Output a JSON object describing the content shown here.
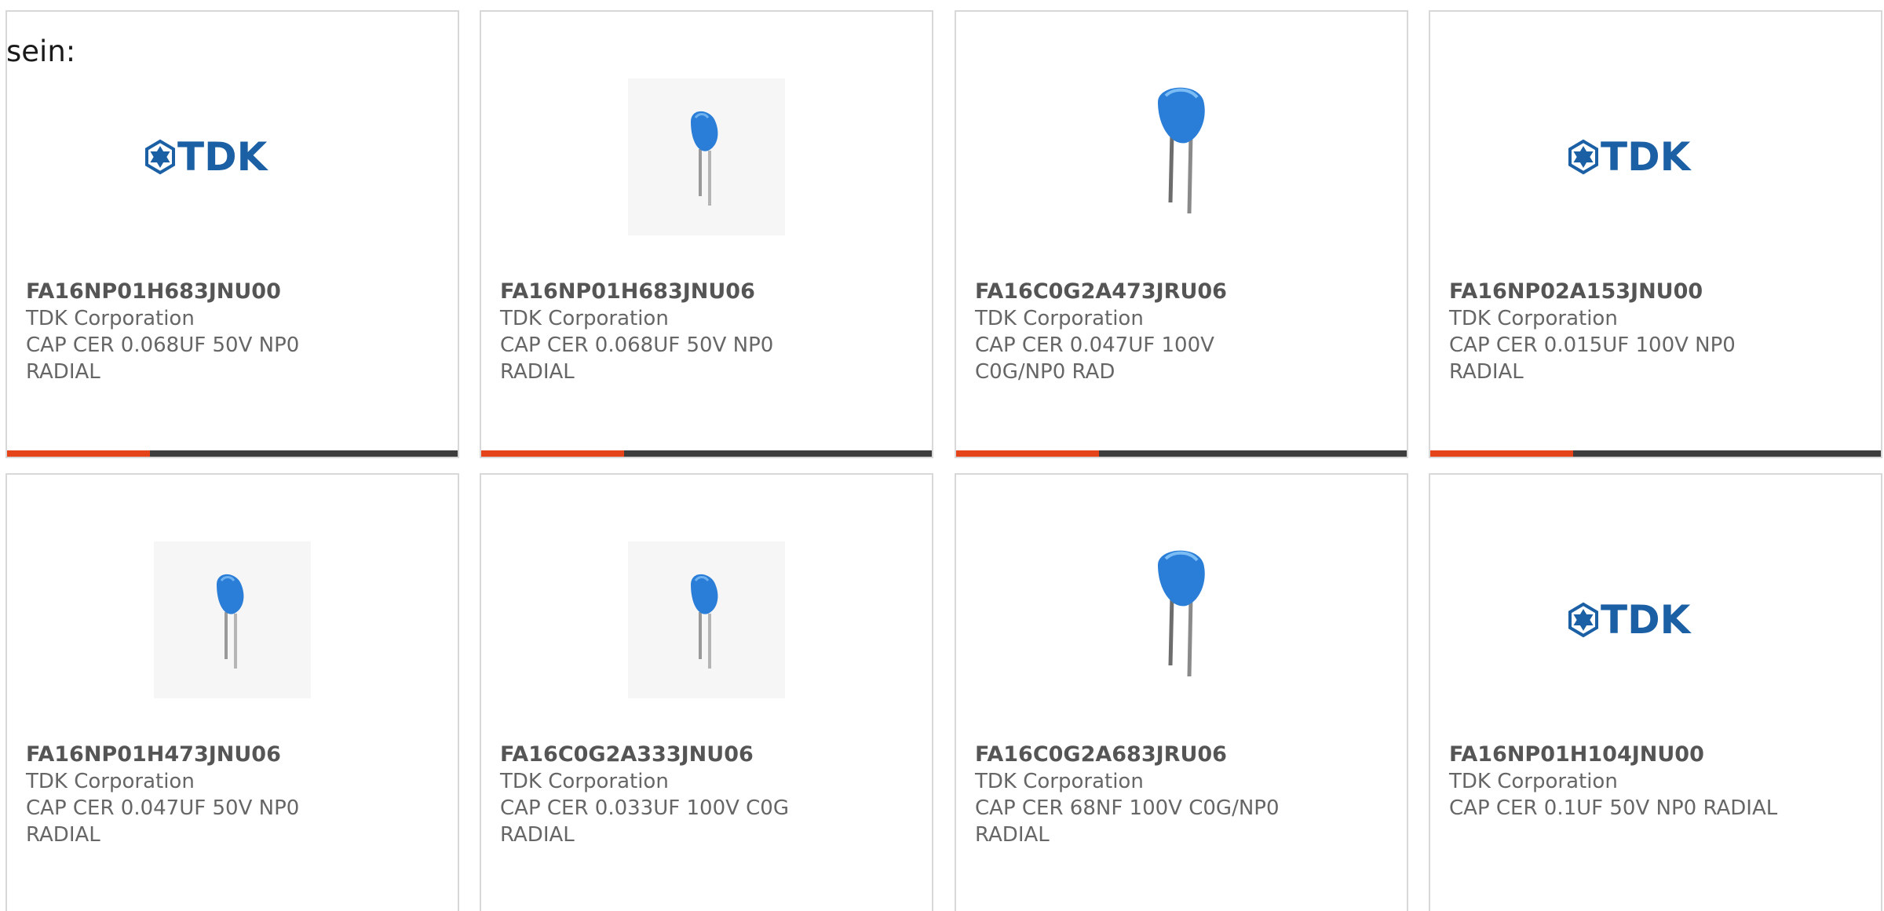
{
  "lead_text": "sein:",
  "colors": {
    "accent": "#e5441a",
    "bar": "#3d3d3d",
    "tdk_blue": "#1b5fa4",
    "capacitor_blue": "#2a7ed8"
  },
  "cards": [
    {
      "part_number": "FA16NP01H683JNU00",
      "manufacturer": "TDK Corporation",
      "description": "CAP CER 0.068UF 50V NP0 RADIAL",
      "image": "tdk-logo",
      "logo_text": "TDK"
    },
    {
      "part_number": "FA16NP01H683JNU06",
      "manufacturer": "TDK Corporation",
      "description": "CAP CER 0.068UF 50V NP0 RADIAL",
      "image": "capacitor-small"
    },
    {
      "part_number": "FA16C0G2A473JRU06",
      "manufacturer": "TDK Corporation",
      "description": "CAP CER 0.047UF 100V C0G/NP0 RAD",
      "image": "capacitor-large"
    },
    {
      "part_number": "FA16NP02A153JNU00",
      "manufacturer": "TDK Corporation",
      "description": "CAP CER 0.015UF 100V NP0 RADIAL",
      "image": "tdk-logo",
      "logo_text": "TDK"
    },
    {
      "part_number": "FA16NP01H473JNU06",
      "manufacturer": "TDK Corporation",
      "description": "CAP CER 0.047UF 50V NP0 RADIAL",
      "image": "capacitor-small"
    },
    {
      "part_number": "FA16C0G2A333JNU06",
      "manufacturer": "TDK Corporation",
      "description": "CAP CER 0.033UF 100V C0G RADIAL",
      "image": "capacitor-small"
    },
    {
      "part_number": "FA16C0G2A683JRU06",
      "manufacturer": "TDK Corporation",
      "description": "CAP CER 68NF 100V C0G/NP0 RADIAL",
      "image": "capacitor-large"
    },
    {
      "part_number": "FA16NP01H104JNU00",
      "manufacturer": "TDK Corporation",
      "description": "CAP CER 0.1UF 50V NP0 RADIAL",
      "image": "tdk-logo",
      "logo_text": "TDK"
    }
  ]
}
